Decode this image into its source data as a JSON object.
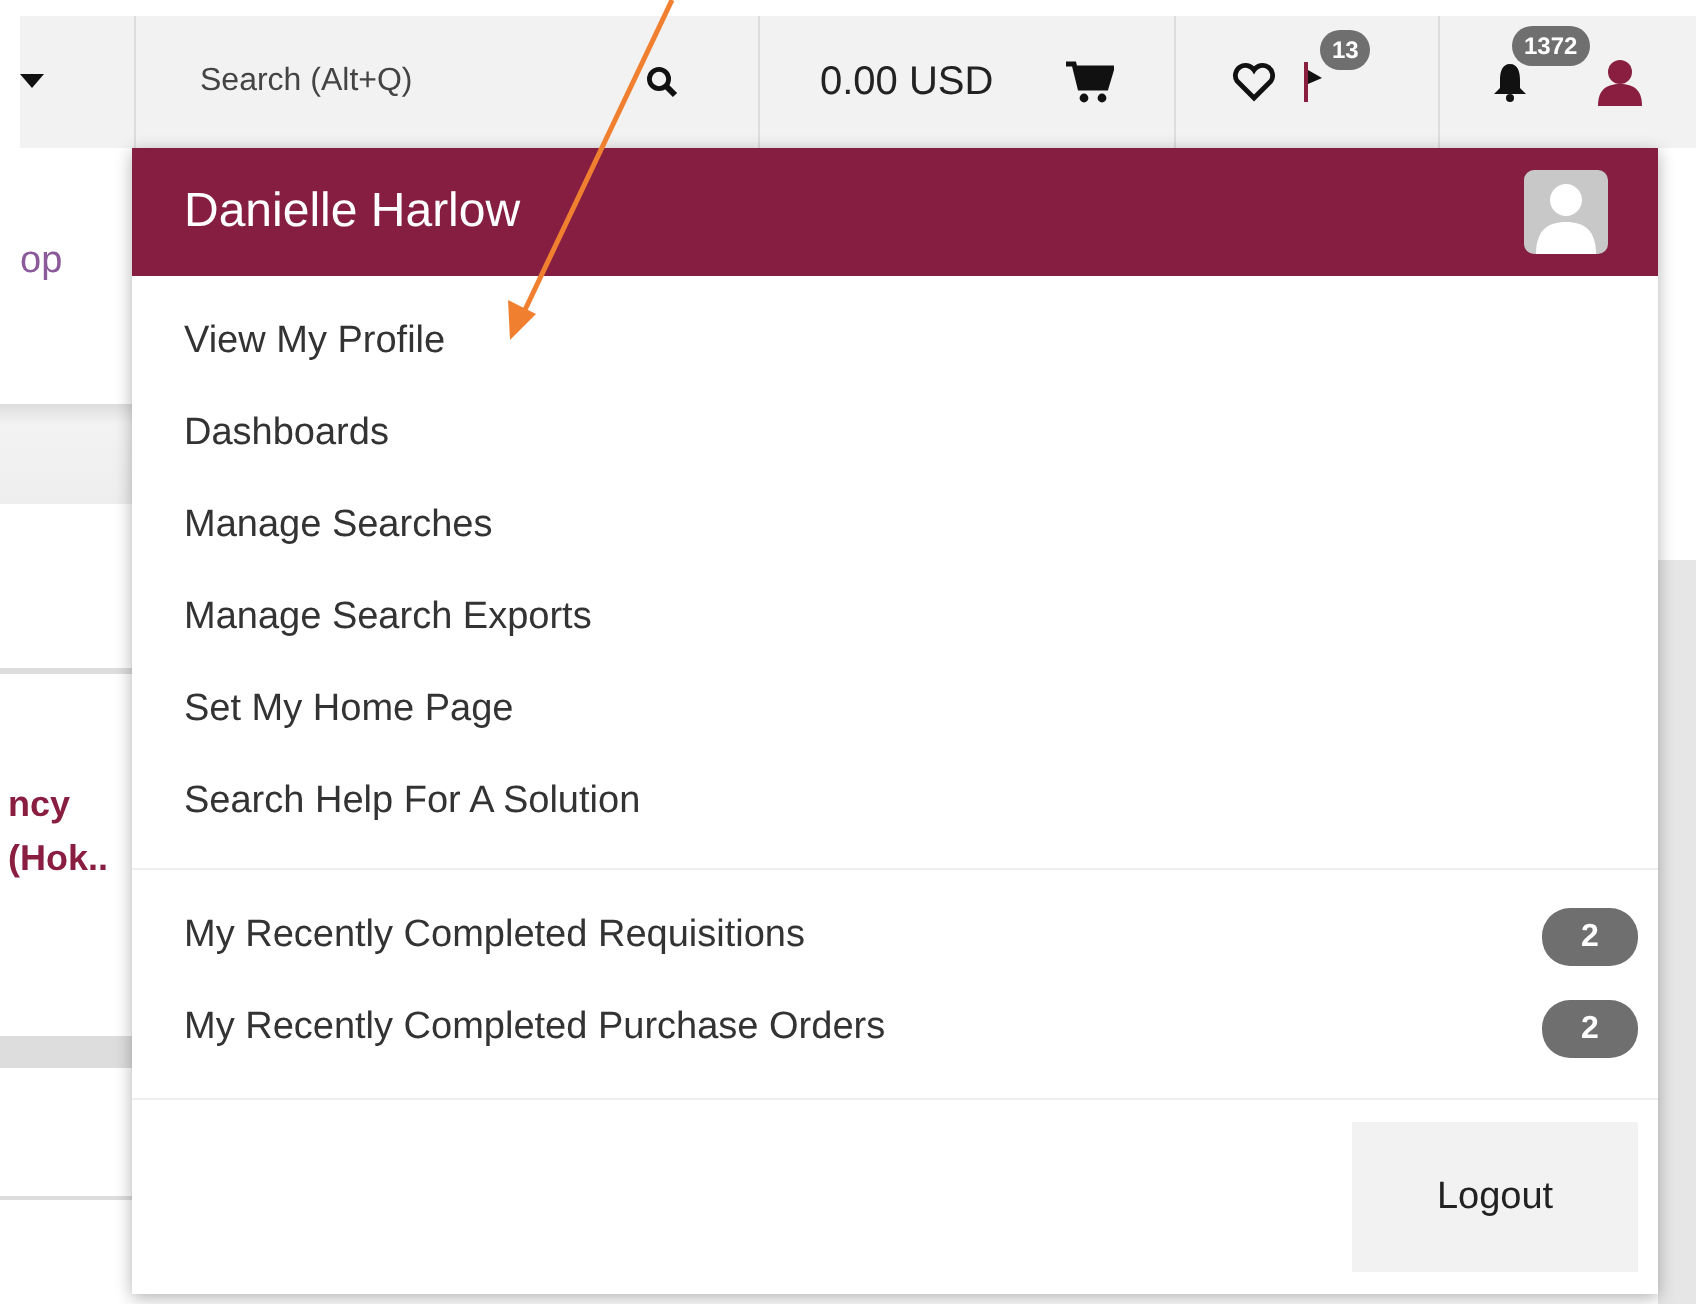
{
  "top_bar": {
    "search": {
      "placeholder": "Search (Alt+Q)"
    },
    "cart_total": "0.00 USD",
    "flag_count": "13",
    "notification_count": "1372"
  },
  "background": {
    "link": "op",
    "item_title": [
      "ncy",
      "(Hok.."
    ]
  },
  "user_menu": {
    "name": "Danielle Harlow",
    "items": [
      {
        "label": "View My Profile"
      },
      {
        "label": "Dashboards"
      },
      {
        "label": "Manage Searches"
      },
      {
        "label": "Manage Search Exports"
      },
      {
        "label": "Set My Home Page"
      },
      {
        "label": "Search Help For A Solution"
      }
    ],
    "recent": [
      {
        "label": "My Recently Completed Requisitions",
        "count": "2"
      },
      {
        "label": "My Recently Completed Purchase Orders",
        "count": "2"
      }
    ],
    "logout": "Logout"
  }
}
